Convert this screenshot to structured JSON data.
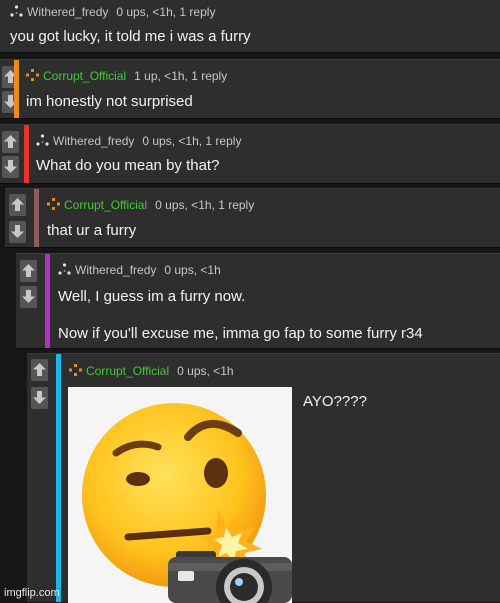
{
  "comments": [
    {
      "username": "Withered_fredy",
      "meta": "0 ups, <1h, 1 reply",
      "lines": [
        "you got lucky, it told me i was a furry"
      ],
      "stripe": "",
      "name_color": "grey"
    },
    {
      "username": "Corrupt_Official",
      "meta": "1 up, <1h, 1 reply",
      "lines": [
        "im honestly not surprised"
      ],
      "stripe": "#ee8a17",
      "name_color": "green"
    },
    {
      "username": "Withered_fredy",
      "meta": "0 ups, <1h, 1 reply",
      "lines": [
        "What do you mean by that?"
      ],
      "stripe": "#e8322e",
      "name_color": "grey"
    },
    {
      "username": "Corrupt_Official",
      "meta": "0 ups, <1h, 1 reply",
      "lines": [
        "that ur a furry"
      ],
      "stripe": "#8e5c5c",
      "name_color": "green"
    },
    {
      "username": "Withered_fredy",
      "meta": "0 ups, <1h",
      "lines": [
        "Well, I guess im a furry now.",
        "Now if you'll excuse me, imma go fap to some furry r34"
      ],
      "stripe": "#b52ec8",
      "name_color": "grey"
    },
    {
      "username": "Corrupt_Official",
      "meta": "0 ups, <1h",
      "lines": [
        "AYO????"
      ],
      "stripe": "#18b8e8",
      "name_color": "green"
    }
  ],
  "icons": {
    "vote_up": "arrow-up-icon",
    "vote_down": "arrow-down-icon",
    "user_grey": "dots-triangle-icon",
    "user_orange": "dots-diamond-icon",
    "image": "thinking-face-with-camera-emoji"
  },
  "colors": {
    "username_green": "#46c834",
    "username_grey": "#c4c4c4",
    "background": "#161616",
    "comment_bg": "#2e2e2e"
  },
  "watermark": "imgflip.com"
}
